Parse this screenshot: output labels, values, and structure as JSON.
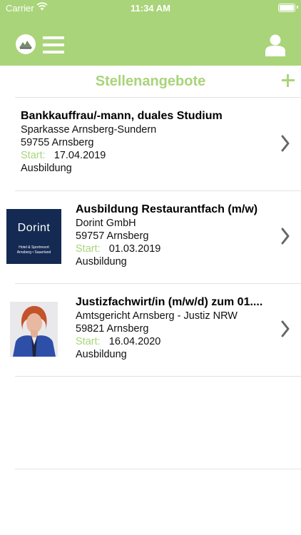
{
  "status_bar": {
    "carrier": "Carrier",
    "time": "11:34 AM"
  },
  "header": {
    "icons": [
      "logo-icon",
      "hamburger-menu-icon",
      "user-profile-icon"
    ]
  },
  "page": {
    "title": "Stellenangebote",
    "add_icon": "plus-icon"
  },
  "colors": {
    "accent": "#a9d479",
    "dorint_blue": "#142a52"
  },
  "jobs": [
    {
      "title": "Bankkauffrau/-mann, duales Studium",
      "company": "Sparkasse Arnsberg-Sundern",
      "location": "59755 Arnsberg",
      "start_label": "Start:",
      "start_date": "17.04.2019",
      "type": "Ausbildung"
    },
    {
      "title": "Ausbildung Restaurantfach (m/w)",
      "company": "Dorint GmbH",
      "location": "59757 Arnsberg",
      "start_label": "Start:",
      "start_date": "01.03.2019",
      "type": "Ausbildung",
      "logo": {
        "word": "Dorint",
        "line1": "Hotel & Sportresort",
        "line2": "Arnsberg • Sauerland"
      }
    },
    {
      "title": "Justizfachwirt/in (m/w/d) zum 01....",
      "company": "Amtsgericht Arnsberg - Justiz NRW",
      "location": "59821 Arnsberg",
      "start_label": "Start:",
      "start_date": "16.04.2020",
      "type": "Ausbildung"
    }
  ]
}
